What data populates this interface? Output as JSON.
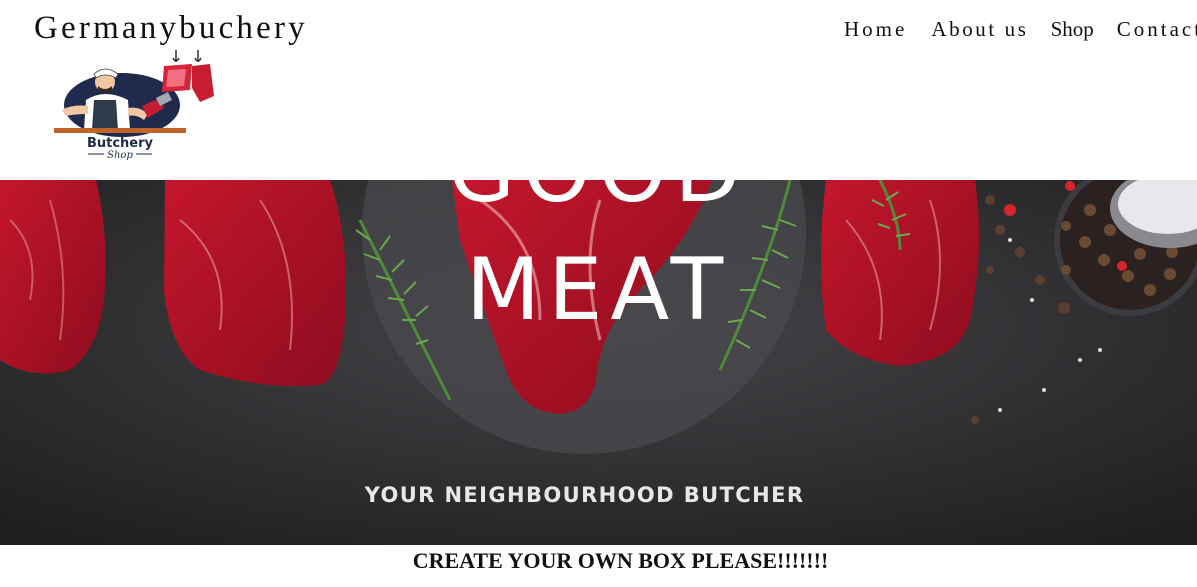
{
  "site": {
    "title": "Germanybuchery"
  },
  "logo": {
    "line1": "Butchery",
    "line2": "Shop"
  },
  "nav": {
    "items": [
      {
        "label": "Home"
      },
      {
        "label": "About us"
      },
      {
        "label": "Shop"
      },
      {
        "label": "Contact"
      }
    ]
  },
  "hero": {
    "word_top": "GOOD",
    "word_main": "MEAT",
    "tagline": "YOUR NEIGHBOURHOOD BUTCHER"
  },
  "cta": {
    "text": "CREATE YOUR OWN BOX PLEASE!!!!!!!"
  },
  "colors": {
    "background": "#ffffff",
    "hero_slate": "#2c2c2e",
    "meat_red": "#b5142a",
    "herb_green": "#4f8a3a",
    "text": "#111111"
  }
}
